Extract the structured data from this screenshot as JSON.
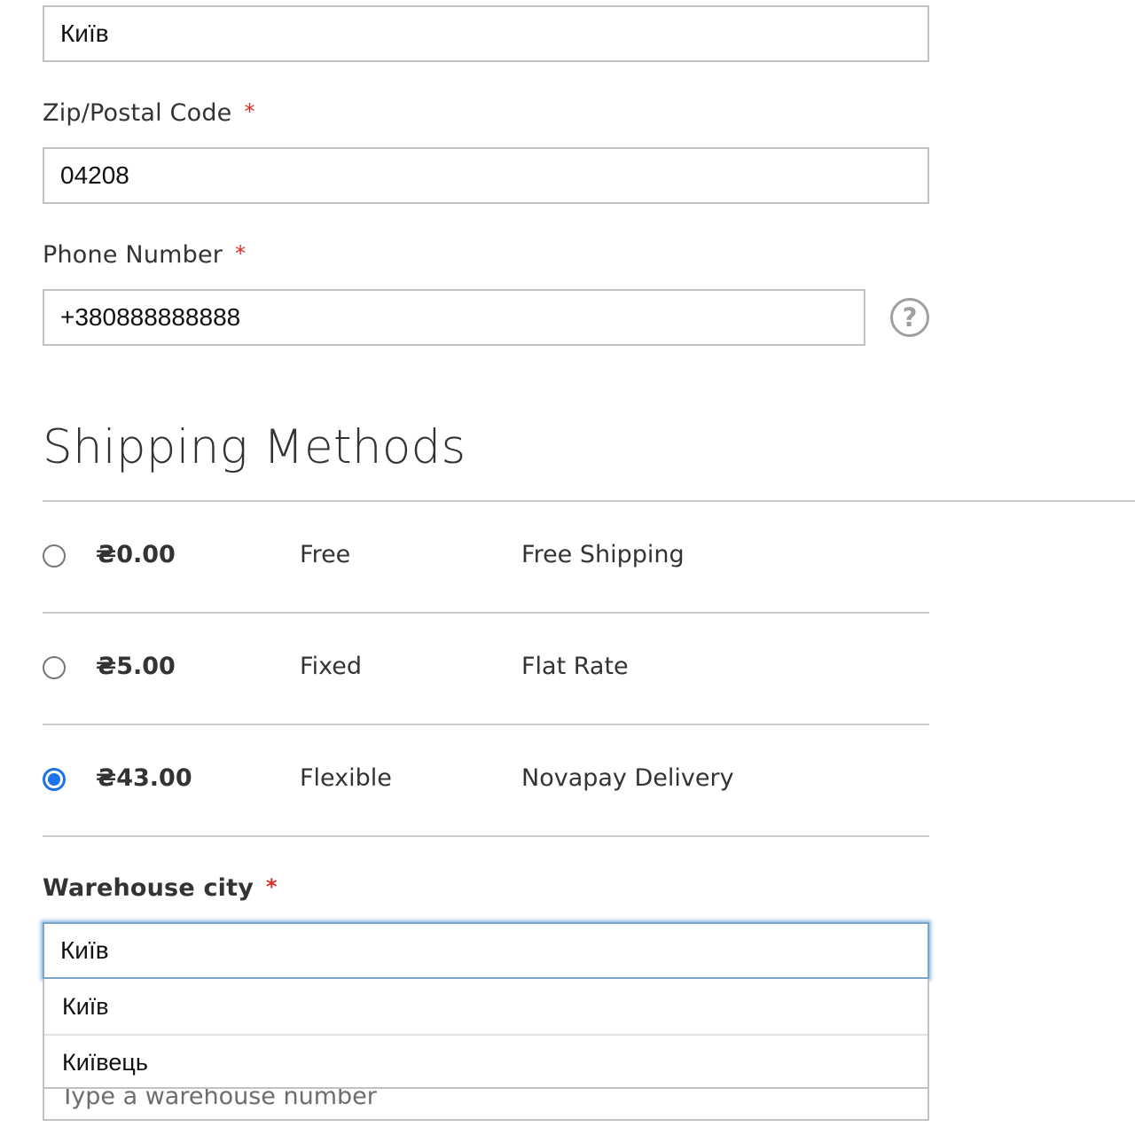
{
  "city_field": {
    "value": "Київ"
  },
  "zip_field": {
    "label": "Zip/Postal Code",
    "required_mark": "*",
    "value": "04208"
  },
  "phone_field": {
    "label": "Phone Number",
    "required_mark": "*",
    "value": "+380888888888",
    "help_icon": "question-circle-icon"
  },
  "shipping": {
    "title": "Shipping Methods",
    "methods": [
      {
        "price": "₴0.00",
        "method": "Free",
        "carrier": "Free Shipping",
        "selected": false
      },
      {
        "price": "₴5.00",
        "method": "Fixed",
        "carrier": "Flat Rate",
        "selected": false
      },
      {
        "price": "₴43.00",
        "method": "Flexible",
        "carrier": "Novapay Delivery",
        "selected": true
      }
    ]
  },
  "warehouse_city": {
    "label": "Warehouse city",
    "required_mark": "*",
    "value": "Київ",
    "suggestions": [
      "Київ",
      "Київець"
    ]
  },
  "warehouse_number": {
    "placeholder": "Type a warehouse number"
  },
  "colors": {
    "accent": "#1a73e8",
    "required": "#e02b27",
    "border": "#c2c2c2"
  }
}
